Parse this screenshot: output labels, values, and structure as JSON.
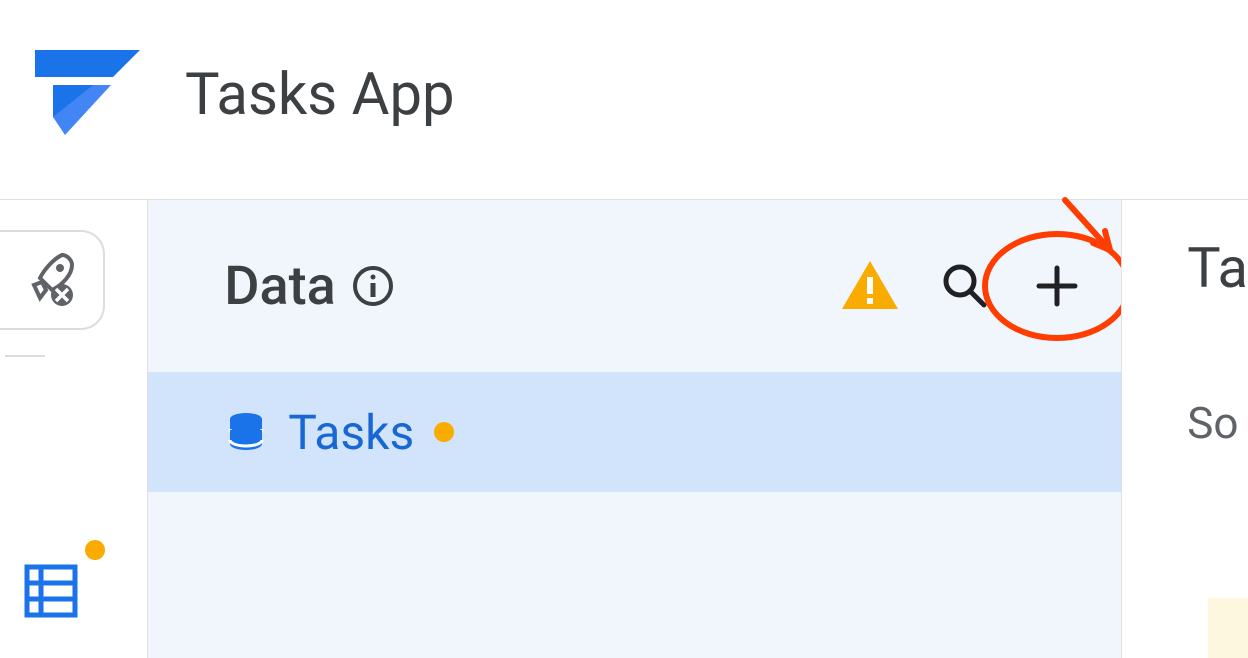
{
  "header": {
    "app_title": "Tasks App"
  },
  "data_panel": {
    "section_label": "Data",
    "tables": [
      {
        "name": "Tasks"
      }
    ]
  },
  "right_panel": {
    "title_fragment": "Ta",
    "subtitle_fragment": "So"
  },
  "colors": {
    "primary_blue": "#1a73e8",
    "link_blue": "#1967d2",
    "selected_bg": "#d2e3fc",
    "panel_bg": "#f1f6fd",
    "warning_orange": "#f9ab00",
    "annotation_red": "#ff3d00"
  }
}
